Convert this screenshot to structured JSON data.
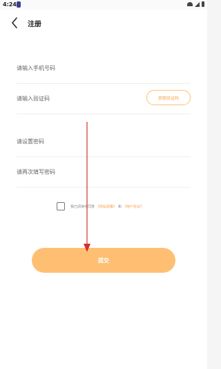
{
  "status_bar": {
    "time": "4:24"
  },
  "header": {
    "title": "注册"
  },
  "form": {
    "phone_placeholder": "请输入手机号码",
    "code_placeholder": "请输入验证码",
    "code_button_label": "获取验证码",
    "password_placeholder": "请设置密码",
    "password_confirm_placeholder": "请再次填写密码"
  },
  "agreement": {
    "prefix": "我已阅读并同意",
    "privacy_link": "《隐私政策》",
    "and": "和",
    "user_link": "《用户协议》"
  },
  "submit": {
    "label": "提交"
  },
  "colors": {
    "accent": "#ffbf73",
    "accent_text": "#f6a34a",
    "annotation_arrow": "#d32f2f"
  }
}
